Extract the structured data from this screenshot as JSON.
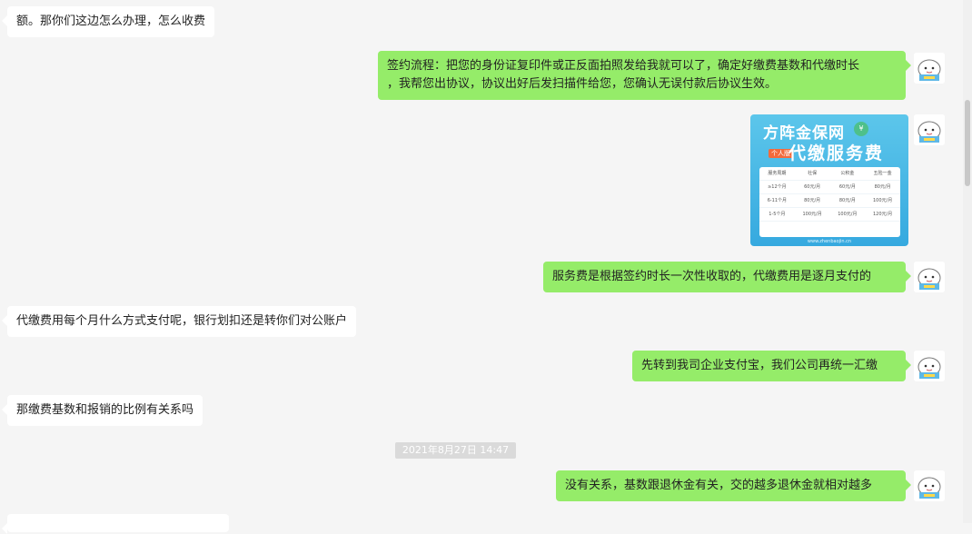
{
  "messages": {
    "m1": "额。那你们这边怎么办理，怎么收费",
    "m2_line1": "签约流程：把您的身份证复印件或正反面拍照发给我就可以了，确定好缴费基数和代缴时长",
    "m2_line2": "，我帮您出协议，协议出好后发扫描件给您，您确认无误付款后协议生效。",
    "m4": "服务费是根据签约时长一次性收取的，代缴费用是逐月支付的",
    "m5": "代缴费用每个月什么方式支付呢，银行划扣还是转你们对公账户",
    "m6": "先转到我司企业支付宝，我们公司再统一汇缴",
    "m7": "那缴费基数和报销的比例有关系吗",
    "timestamp": "2021年8月27日 14:47",
    "m8": "没有关系，基数跟退休金有关，交的越多退休金就相对越多"
  },
  "card": {
    "title1": "方阵金保网",
    "title2": "代缴服务费",
    "tag": "个人版",
    "headers": [
      "服务周期",
      "社保",
      "公积金",
      "五险一金"
    ],
    "rows": [
      [
        "≥12个月",
        "60元/月",
        "60元/月",
        "80元/月"
      ],
      [
        "6-11个月",
        "80元/月",
        "80元/月",
        "100元/月"
      ],
      [
        "1-5个月",
        "100元/月",
        "100元/月",
        "120元/月"
      ]
    ],
    "footer": "www.zhenbaojin.cn"
  },
  "avatar_icon": "cartoon-avatar-icon"
}
